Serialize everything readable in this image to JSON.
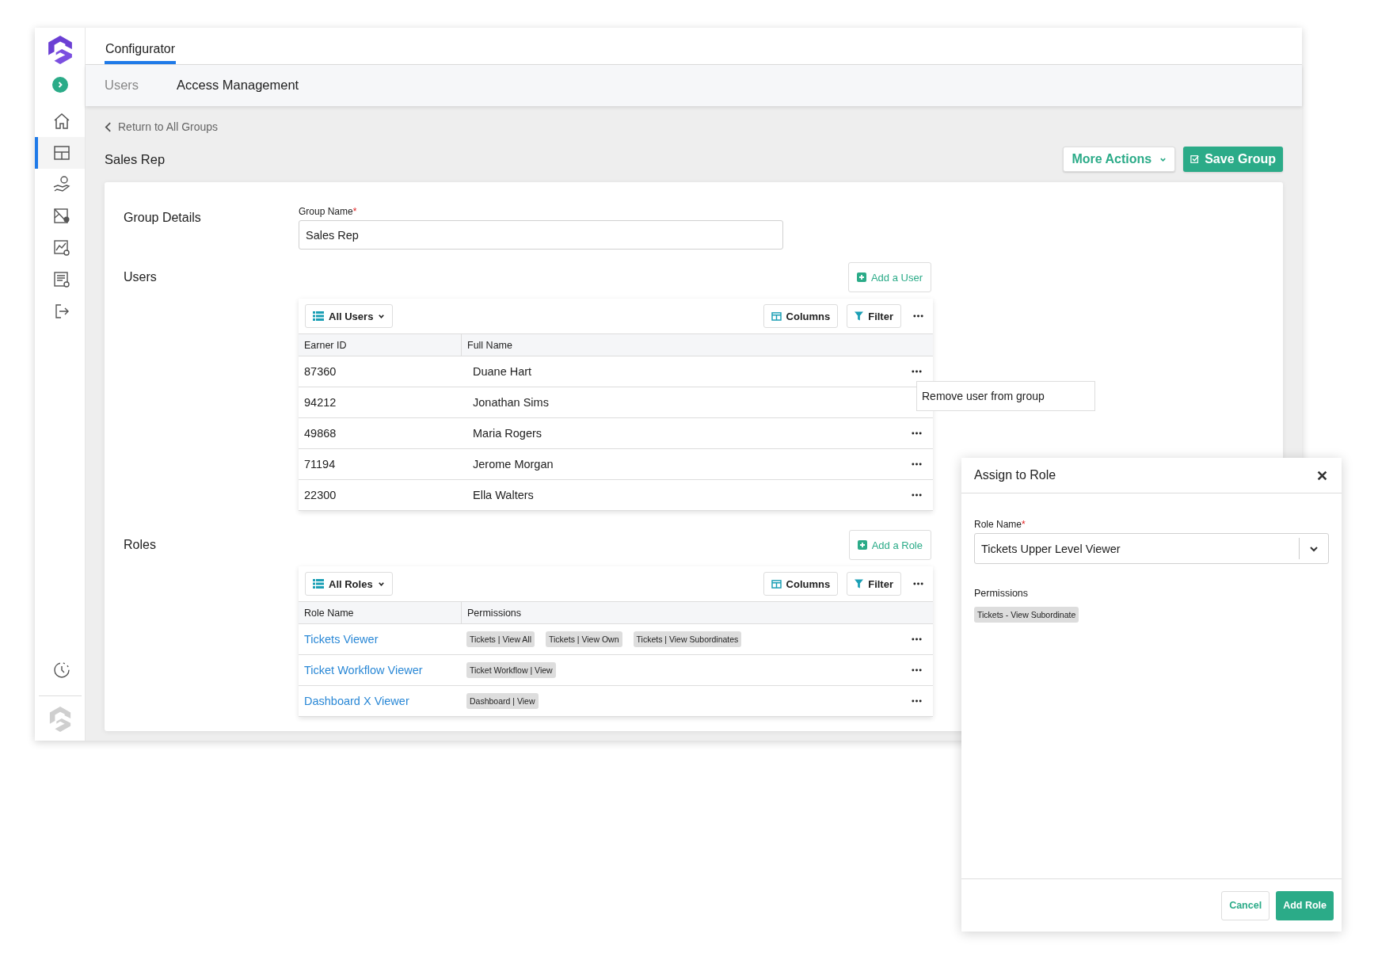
{
  "sidebar": {
    "nav": [
      {
        "selected": false
      },
      {
        "selected": true
      },
      {
        "selected": false
      },
      {
        "selected": false
      },
      {
        "selected": false
      },
      {
        "selected": false
      },
      {
        "selected": false
      }
    ],
    "bottom_nav": [
      {
        "selected": false
      }
    ]
  },
  "header": {
    "tabs": [
      {
        "label": "Configurator",
        "selected": true
      }
    ]
  },
  "subnav": {
    "tabs": [
      {
        "label": "Users",
        "selected": false
      },
      {
        "label": "Access Management",
        "selected": true
      }
    ]
  },
  "back_link": "Return to All Groups",
  "page_title": "Sales Rep",
  "actions": {
    "more_actions": "More Actions",
    "save": "Save Group"
  },
  "group_details": {
    "heading": "Group Details",
    "field_label": "Group Name",
    "required_mark": "*",
    "value": "Sales Rep"
  },
  "users": {
    "heading": "Users",
    "add_button": "Add a User",
    "view": "All Users",
    "columns_button": "Columns",
    "filter_button": "Filter",
    "columns": [
      "Earner ID",
      "Full Name"
    ],
    "rows": [
      {
        "earner_id": "87360",
        "full_name": "Duane Hart",
        "menu_open": false
      },
      {
        "earner_id": "94212",
        "full_name": "Jonathan Sims",
        "menu_open": true
      },
      {
        "earner_id": "49868",
        "full_name": "Maria Rogers",
        "menu_open": false
      },
      {
        "earner_id": "71194",
        "full_name": "Jerome Morgan",
        "menu_open": false
      },
      {
        "earner_id": "22300",
        "full_name": "Ella Walters",
        "menu_open": false
      }
    ],
    "row_menu": [
      "Remove user from group"
    ]
  },
  "roles": {
    "heading": "Roles",
    "add_button": "Add a Role",
    "view": "All Roles",
    "columns_button": "Columns",
    "filter_button": "Filter",
    "columns": [
      "Role Name",
      "Permissions"
    ],
    "rows": [
      {
        "role_name": "Tickets Viewer",
        "permissions": [
          "Tickets | View All",
          "Tickets | View Own",
          "Tickets | View Subordinates"
        ]
      },
      {
        "role_name": "Ticket Workflow Viewer",
        "permissions": [
          "Ticket Workflow | View"
        ]
      },
      {
        "role_name": "Dashboard X Viewer",
        "permissions": [
          "Dashboard | View"
        ]
      }
    ]
  },
  "dialog": {
    "title": "Assign to Role",
    "field_label": "Role Name",
    "required_mark": "*",
    "value": "Tickets Upper Level Viewer",
    "permissions_label": "Permissions",
    "permissions": [
      "Tickets - View Subordinate"
    ],
    "cancel": "Cancel",
    "submit": "Add Role"
  }
}
